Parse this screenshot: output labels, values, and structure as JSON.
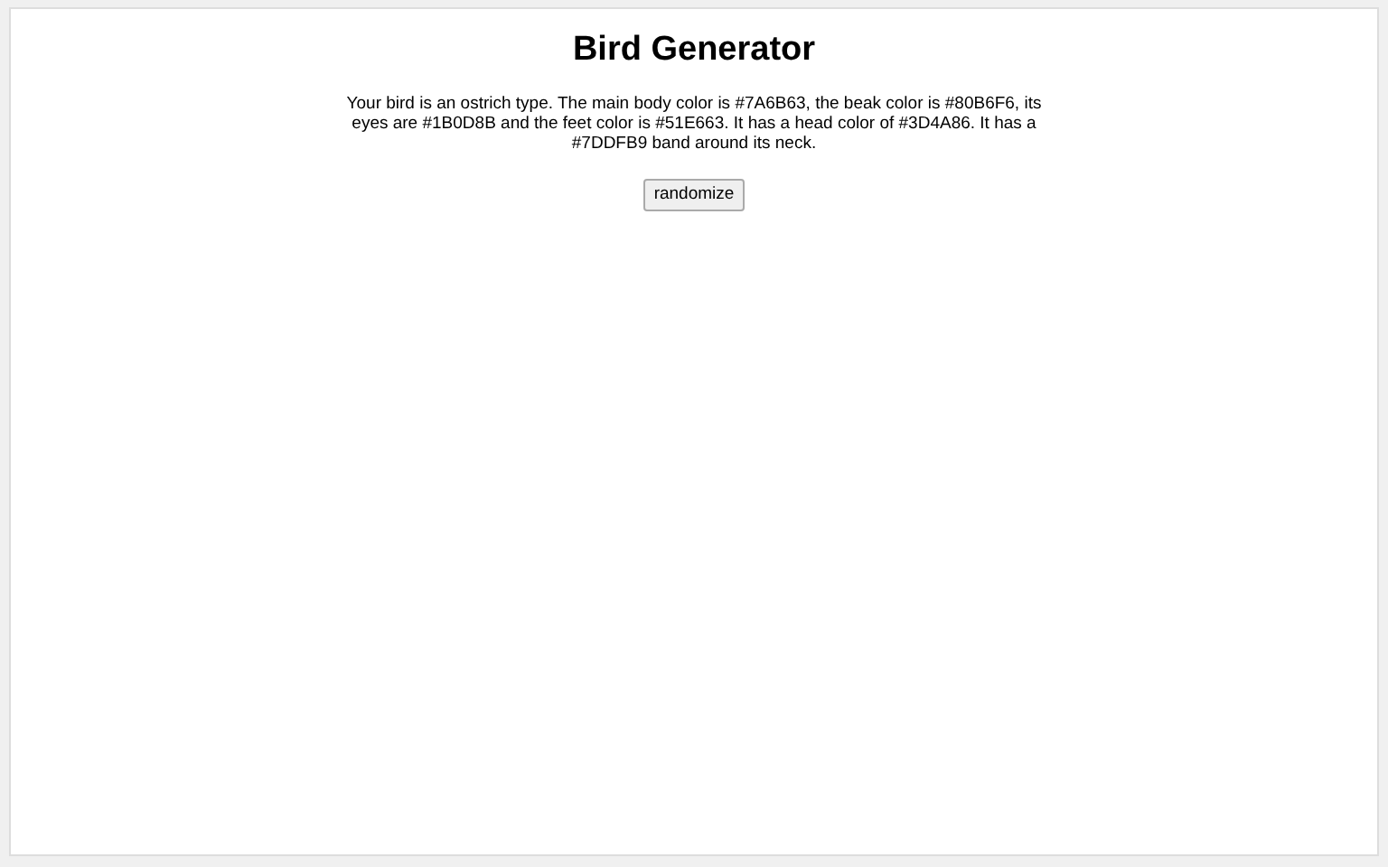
{
  "title": "Bird Generator",
  "description": "Your bird is an ostrich type. The main body color is #7A6B63, the beak color is #80B6F6, its eyes are #1B0D8B and the feet color is #51E663. It has a head color of #3D4A86. It has a #7DDFB9 band around its neck.",
  "button": "randomize"
}
